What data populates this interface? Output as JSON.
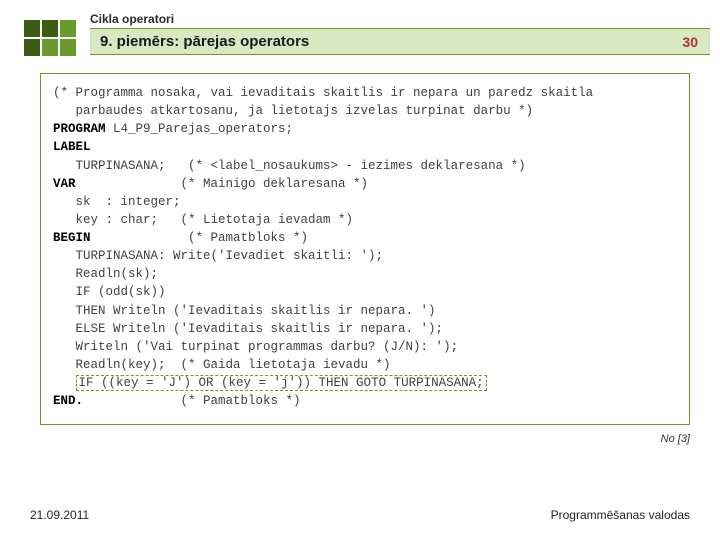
{
  "header": {
    "breadcrumb": "Cikla operatori",
    "title": "9. piemērs: pārejas operators",
    "page_number": "30"
  },
  "code": {
    "c1": "(* Programma nosaka, vai ievaditais skaitlis ir nepara un paredz skaitla",
    "c2": "   parbaudes atkartosanu, ja lietotajs izvelas turpinat darbu *)",
    "kw_program": "PROGRAM",
    "prog_name": " L4_P9_Parejas_operators;",
    "kw_label": "LABEL",
    "lbl_item": "   TURPINASANA;   (* <label_nosaukums> - iezimes deklaresana *)",
    "kw_var": "VAR",
    "var_comment": "              (* Mainigo deklaresana *)",
    "var_sk": "   sk  : integer;",
    "var_key": "   key : char;   (* Lietotaja ievadam *)",
    "kw_begin": "BEGIN",
    "begin_comment": "             (* Pamatbloks *)",
    "l1": "   TURPINASANA: Write('Ievadiet skaitli: ');",
    "l2": "   Readln(sk);",
    "l3": "   IF (odd(sk))",
    "l4": "   THEN Writeln ('Ievaditais skaitlis ir nepara. ')",
    "l5": "   ELSE Writeln ('Ievaditais skaitlis ir nepara. ');",
    "l6": "   Writeln ('Vai turpinat programmas darbu? (J/N): ');",
    "l7": "   Readln(key);  (* Gaida lietotaja ievadu *)",
    "goto_prefix": "   ",
    "goto_line": "IF ((key = 'J') OR (key = 'j')) THEN GOTO TURPINASANA;",
    "kw_end": "END.",
    "end_comment": "             (* Pamatbloks *)"
  },
  "reference": "No [3]",
  "footer": {
    "date": "21.09.2011",
    "course": "Programmēšanas valodas"
  }
}
